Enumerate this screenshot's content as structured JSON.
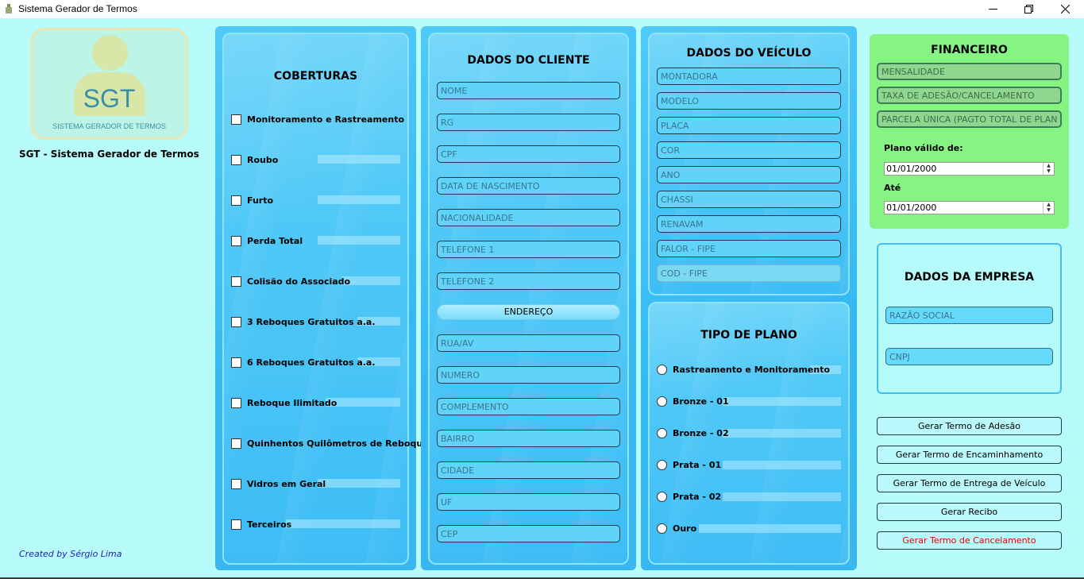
{
  "window": {
    "title": "Sistema Gerador de Termos"
  },
  "sidebar": {
    "logo_text": "SGT",
    "logo_subtitle": "SISTEMA GERADOR DE TERMOS",
    "app_name": "SGT - Sistema Gerador de Termos",
    "credit": "Created by Sérgio Lima"
  },
  "coberturas": {
    "title": "COBERTURAS",
    "items": [
      "Monitoramento e Rastreamento",
      "Roubo",
      "Furto",
      "Perda Total",
      "Colisão do Associado",
      "3 Reboques Gratuitos a.a.",
      "6 Reboques Gratuitos a.a.",
      "Reboque Ilimitado",
      "Quinhentos Quilômetros de Reboque",
      "Vidros em Geral",
      "Terceiros"
    ]
  },
  "cliente": {
    "title": "DADOS DO CLIENTE",
    "fields": [
      "NOME",
      "RG",
      "CPF",
      "DATA DE NASCIMENTO",
      "NACIONALIDADE",
      "TELEFONE 1",
      "TELEFONE 2"
    ],
    "endereco_label": "ENDEREÇO",
    "endereco_fields": [
      "RUA/AV",
      "NUMERO",
      "COMPLEMENTO",
      "BAIRRO",
      "CIDADE",
      "UF",
      "CEP"
    ]
  },
  "veiculo": {
    "title": "DADOS DO VEÍCULO",
    "fields": [
      "MONTADORA",
      "MODELO",
      "PLACA",
      "COR",
      "ANO",
      "CHASSI",
      "RENAVAM",
      "FALOR - FIPE",
      "COD - FIPE"
    ]
  },
  "plano": {
    "title": "TIPO DE PLANO",
    "options": [
      "Rastreamento e Monitoramento",
      "Bronze - 01",
      "Bronze - 02",
      "Prata - 01",
      "Prata - 02",
      "Ouro"
    ]
  },
  "financeiro": {
    "title": "FINANCEIRO",
    "fields": [
      "MENSALIDADE",
      "TAXA DE ADESÃO/CANCELAMENTO",
      "PARCELA ÚNICA (PAGTO TOTAL DE PLANO)"
    ],
    "valid_from_label": "Plano válido de:",
    "valid_from": "01/01/2000",
    "valid_to_label": "Até",
    "valid_to": "01/01/2000"
  },
  "empresa": {
    "title": "DADOS DA EMPRESA",
    "fields": [
      "RAZÃO SOCIAL",
      "CNPJ"
    ]
  },
  "actions": {
    "adesao": "Gerar Termo de Adesão",
    "encaminhamento": "Gerar Termo de Encaminhamento",
    "entrega": "Gerar Termo de Entrega de Veículo",
    "recibo": "Gerar Recibo",
    "cancelamento": "Gerar Termo de Cancelamento",
    "cancel_color": "#e30000"
  }
}
